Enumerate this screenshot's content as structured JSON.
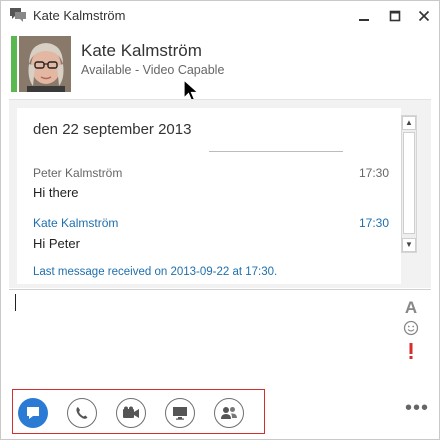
{
  "window": {
    "title": "Kate Kalmström"
  },
  "contact": {
    "name": "Kate Kalmström",
    "status": "Available - Video Capable",
    "presence_color": "#59b84f"
  },
  "conversation": {
    "date": "den 22 september 2013",
    "messages": [
      {
        "sender": "Peter Kalmström",
        "time": "17:30",
        "text": "Hi there",
        "sender_color": "#666666"
      },
      {
        "sender": "Kate Kalmström",
        "time": "17:30",
        "text": "Hi Peter",
        "sender_color": "#1e6fae"
      }
    ],
    "last_received": "Last message received on 2013-09-22 at 17:30."
  },
  "compose": {
    "value": "",
    "font_icon": "A"
  },
  "toolbar": {
    "buttons": [
      {
        "icon": "im-icon",
        "active": true
      },
      {
        "icon": "phone-icon",
        "active": false
      },
      {
        "icon": "video-icon",
        "active": false
      },
      {
        "icon": "present-icon",
        "active": false
      },
      {
        "icon": "participants-icon",
        "active": false
      }
    ],
    "more": "•••"
  },
  "colors": {
    "accent": "#2b7bd4",
    "link": "#1e6fae",
    "important": "#d62d2d"
  }
}
